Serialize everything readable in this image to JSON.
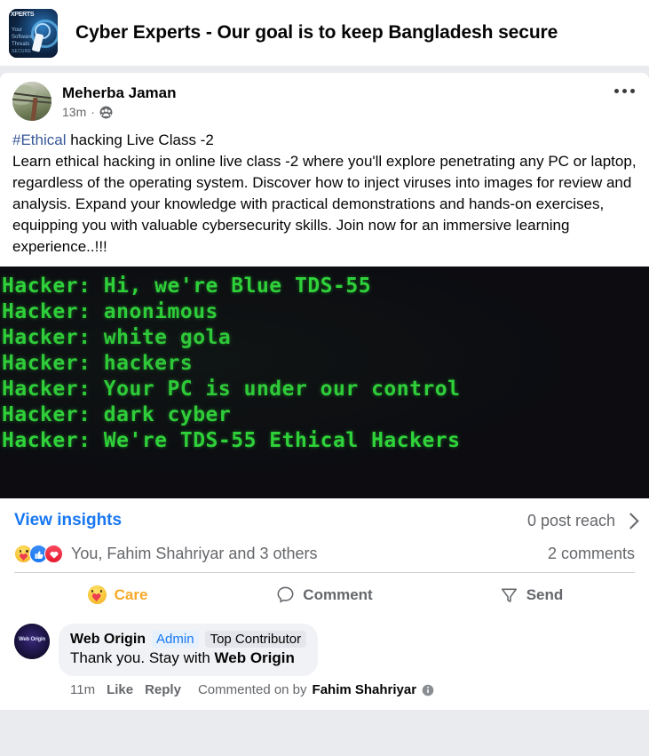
{
  "group": {
    "name": "Cyber Experts - Our goal is to keep Bangladesh secure",
    "avatar_alt": "group-cover-avatar",
    "avatar_text_top": "XPERTS",
    "avatar_text_mid": "Your Software Threats",
    "avatar_text_bottom": "SECURE"
  },
  "post": {
    "author": "Meherba Jaman",
    "time": "13m",
    "separator": "·",
    "privacy": "group-privacy-icon",
    "more_label": "more-options",
    "text": {
      "hashtag": "#Ethical",
      "title_rest": " hacking Live Class -2",
      "body": "Learn ethical hacking in online live class -2  where you'll explore penetrating any PC or laptop, regardless of the operating system. Discover how to inject viruses into images for review and analysis. Expand your knowledge with practical demonstrations and hands-on exercises, equipping you with valuable cybersecurity skills. Join now for an immersive learning experience..!!!"
    },
    "attachment": {
      "type": "terminal-screenshot",
      "background_color": "#0c0c11",
      "text_color": "#2fd63a",
      "lines": [
        "Hacker: Hi, we're Blue TDS-55",
        "Hacker: anonimous",
        "Hacker: white gola",
        "Hacker: hackers",
        "Hacker: Your PC is under our control",
        "Hacker: dark cyber",
        "Hacker: We're TDS-55 Ethical Hackers"
      ]
    }
  },
  "insights": {
    "view_label": "View insights",
    "reach_label": "0 post reach",
    "chevron": "chevron-right-icon"
  },
  "reactions": {
    "icons": [
      "care-reaction-icon",
      "like-reaction-icon",
      "love-reaction-icon"
    ],
    "summary": "You, Fahim Shahriyar and 3 others",
    "comments_count": "2 comments"
  },
  "actions": {
    "care": "Care",
    "comment": "Comment",
    "send": "Send",
    "active": "Care",
    "active_color": "#f7a928"
  },
  "comment": {
    "author": "Web Origin",
    "badge_admin": "Admin",
    "badge_top": "Top Contributor",
    "text_start": "Thank you. Stay with ",
    "text_bold": "Web Origin",
    "time": "11m",
    "like": "Like",
    "reply": "Reply",
    "commented_prefix": "Commented on by ",
    "commented_by": "Fahim Shahriyar",
    "info_icon": "info-icon",
    "avatar_text": "Web Origin"
  }
}
